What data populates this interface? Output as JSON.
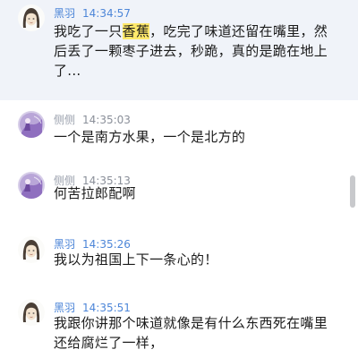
{
  "colors": {
    "self_name": "#4d86d8",
    "other_name": "#9aa0ad",
    "active_row": "#f0f3f9",
    "highlight": "#ffe96b",
    "message_text": "#1b1b1b"
  },
  "messages": [
    {
      "sender": "黑羽",
      "time": "14:34:57",
      "avatar": "woman-avatar",
      "text_before": "我吃了一只",
      "highlight": "香蕉",
      "text_after": "，吃完了味道还留在嘴里，然后丢了一颗枣子进去，秒跪，真的是跪在地上了..."
    },
    {
      "sender": "侧侧",
      "time": "14:35:03",
      "avatar": "purple-figure-avatar",
      "text": "一个是南方水果，一个是北方的"
    },
    {
      "sender": "侧侧",
      "time": "14:35:13",
      "avatar": "purple-figure-avatar",
      "text": "何苦拉郎配啊"
    },
    {
      "sender": "黑羽",
      "time": "14:35:26",
      "avatar": "woman-avatar",
      "text": "我以为祖国上下一条心的！"
    },
    {
      "sender": "黑羽",
      "time": "14:35:51",
      "avatar": "woman-avatar",
      "text": "我跟你讲那个味道就像是有什么东西死在嘴里还给腐烂了一样，"
    }
  ]
}
